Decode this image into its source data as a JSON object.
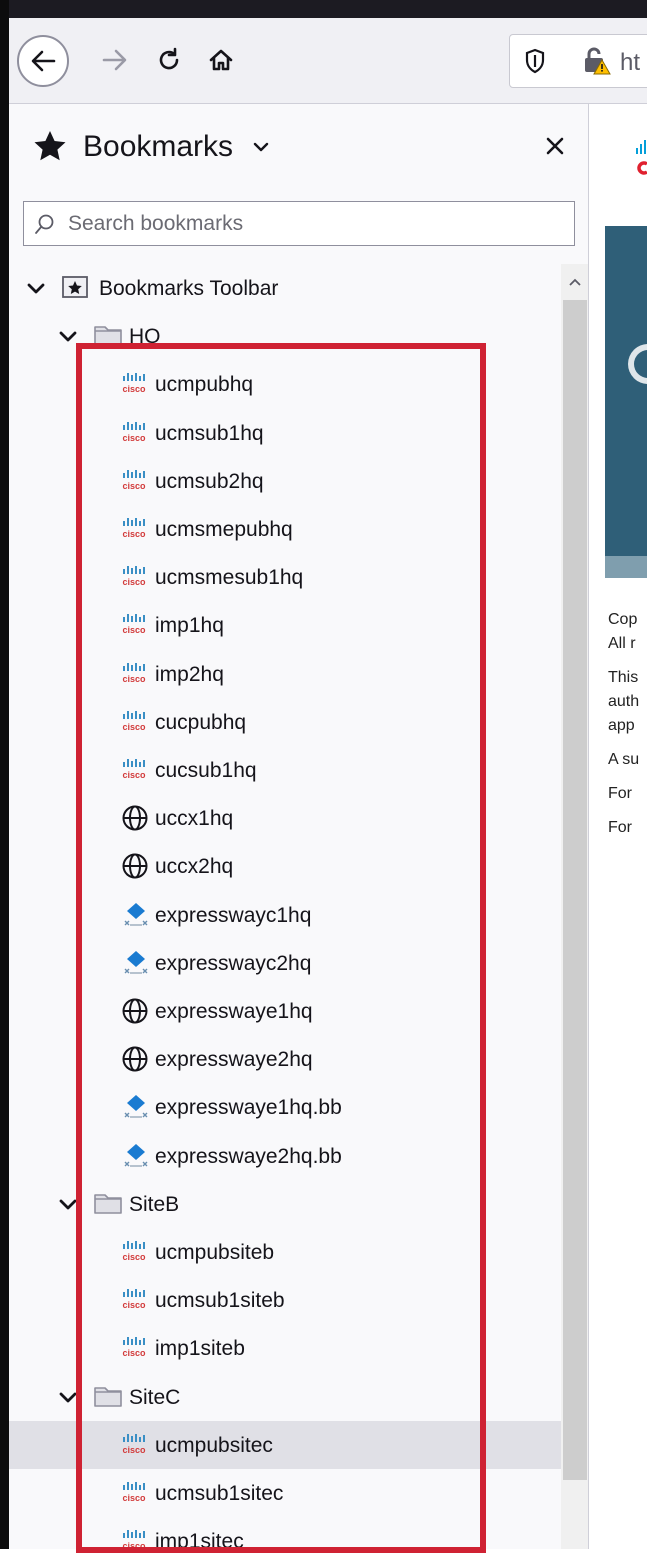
{
  "browser": {
    "url_partial": "ht"
  },
  "sidebar": {
    "title": "Bookmarks",
    "search_placeholder": "Search bookmarks"
  },
  "tree": [
    {
      "kind": "folder-root",
      "label": "Bookmarks Toolbar",
      "depth": 0,
      "icon": "toolbar-icon"
    },
    {
      "kind": "folder",
      "label": "HQ",
      "depth": 1,
      "icon": "folder-icon"
    },
    {
      "kind": "item",
      "label": "ucmpubhq",
      "depth": 2,
      "icon": "cisco-icon"
    },
    {
      "kind": "item",
      "label": "ucmsub1hq",
      "depth": 2,
      "icon": "cisco-icon"
    },
    {
      "kind": "item",
      "label": "ucmsub2hq",
      "depth": 2,
      "icon": "cisco-icon"
    },
    {
      "kind": "item",
      "label": "ucmsmepubhq",
      "depth": 2,
      "icon": "cisco-icon"
    },
    {
      "kind": "item",
      "label": "ucmsmesub1hq",
      "depth": 2,
      "icon": "cisco-icon"
    },
    {
      "kind": "item",
      "label": "imp1hq",
      "depth": 2,
      "icon": "cisco-icon"
    },
    {
      "kind": "item",
      "label": "imp2hq",
      "depth": 2,
      "icon": "cisco-icon"
    },
    {
      "kind": "item",
      "label": "cucpubhq",
      "depth": 2,
      "icon": "cisco-icon"
    },
    {
      "kind": "item",
      "label": "cucsub1hq",
      "depth": 2,
      "icon": "cisco-icon"
    },
    {
      "kind": "item",
      "label": "uccx1hq",
      "depth": 2,
      "icon": "globe-icon"
    },
    {
      "kind": "item",
      "label": "uccx2hq",
      "depth": 2,
      "icon": "globe-icon"
    },
    {
      "kind": "item",
      "label": "expresswayc1hq",
      "depth": 2,
      "icon": "expressway-icon"
    },
    {
      "kind": "item",
      "label": "expresswayc2hq",
      "depth": 2,
      "icon": "expressway-icon"
    },
    {
      "kind": "item",
      "label": "expresswaye1hq",
      "depth": 2,
      "icon": "globe-icon"
    },
    {
      "kind": "item",
      "label": "expresswaye2hq",
      "depth": 2,
      "icon": "globe-icon"
    },
    {
      "kind": "item",
      "label": "expresswaye1hq.bb",
      "depth": 2,
      "icon": "expressway-icon"
    },
    {
      "kind": "item",
      "label": "expresswaye2hq.bb",
      "depth": 2,
      "icon": "expressway-icon"
    },
    {
      "kind": "folder",
      "label": "SiteB",
      "depth": 1,
      "icon": "folder-icon"
    },
    {
      "kind": "item",
      "label": "ucmpubsiteb",
      "depth": 2,
      "icon": "cisco-icon"
    },
    {
      "kind": "item",
      "label": "ucmsub1siteb",
      "depth": 2,
      "icon": "cisco-icon"
    },
    {
      "kind": "item",
      "label": "imp1siteb",
      "depth": 2,
      "icon": "cisco-icon"
    },
    {
      "kind": "folder",
      "label": "SiteC",
      "depth": 1,
      "icon": "folder-icon"
    },
    {
      "kind": "item",
      "label": "ucmpubsitec",
      "depth": 2,
      "icon": "cisco-icon",
      "hover": true
    },
    {
      "kind": "item",
      "label": "ucmsub1sitec",
      "depth": 2,
      "icon": "cisco-icon"
    },
    {
      "kind": "item",
      "label": "imp1sitec",
      "depth": 2,
      "icon": "cisco-icon"
    }
  ],
  "content": {
    "lines": [
      "Cop",
      "All r",
      "This",
      "auth",
      "app",
      "A su",
      "For",
      "For"
    ]
  },
  "colors": {
    "highlight": "#cf2233",
    "banner": "#2f5f78",
    "cisco_blue": "#049fd9",
    "cisco_red": "#e0212f"
  }
}
